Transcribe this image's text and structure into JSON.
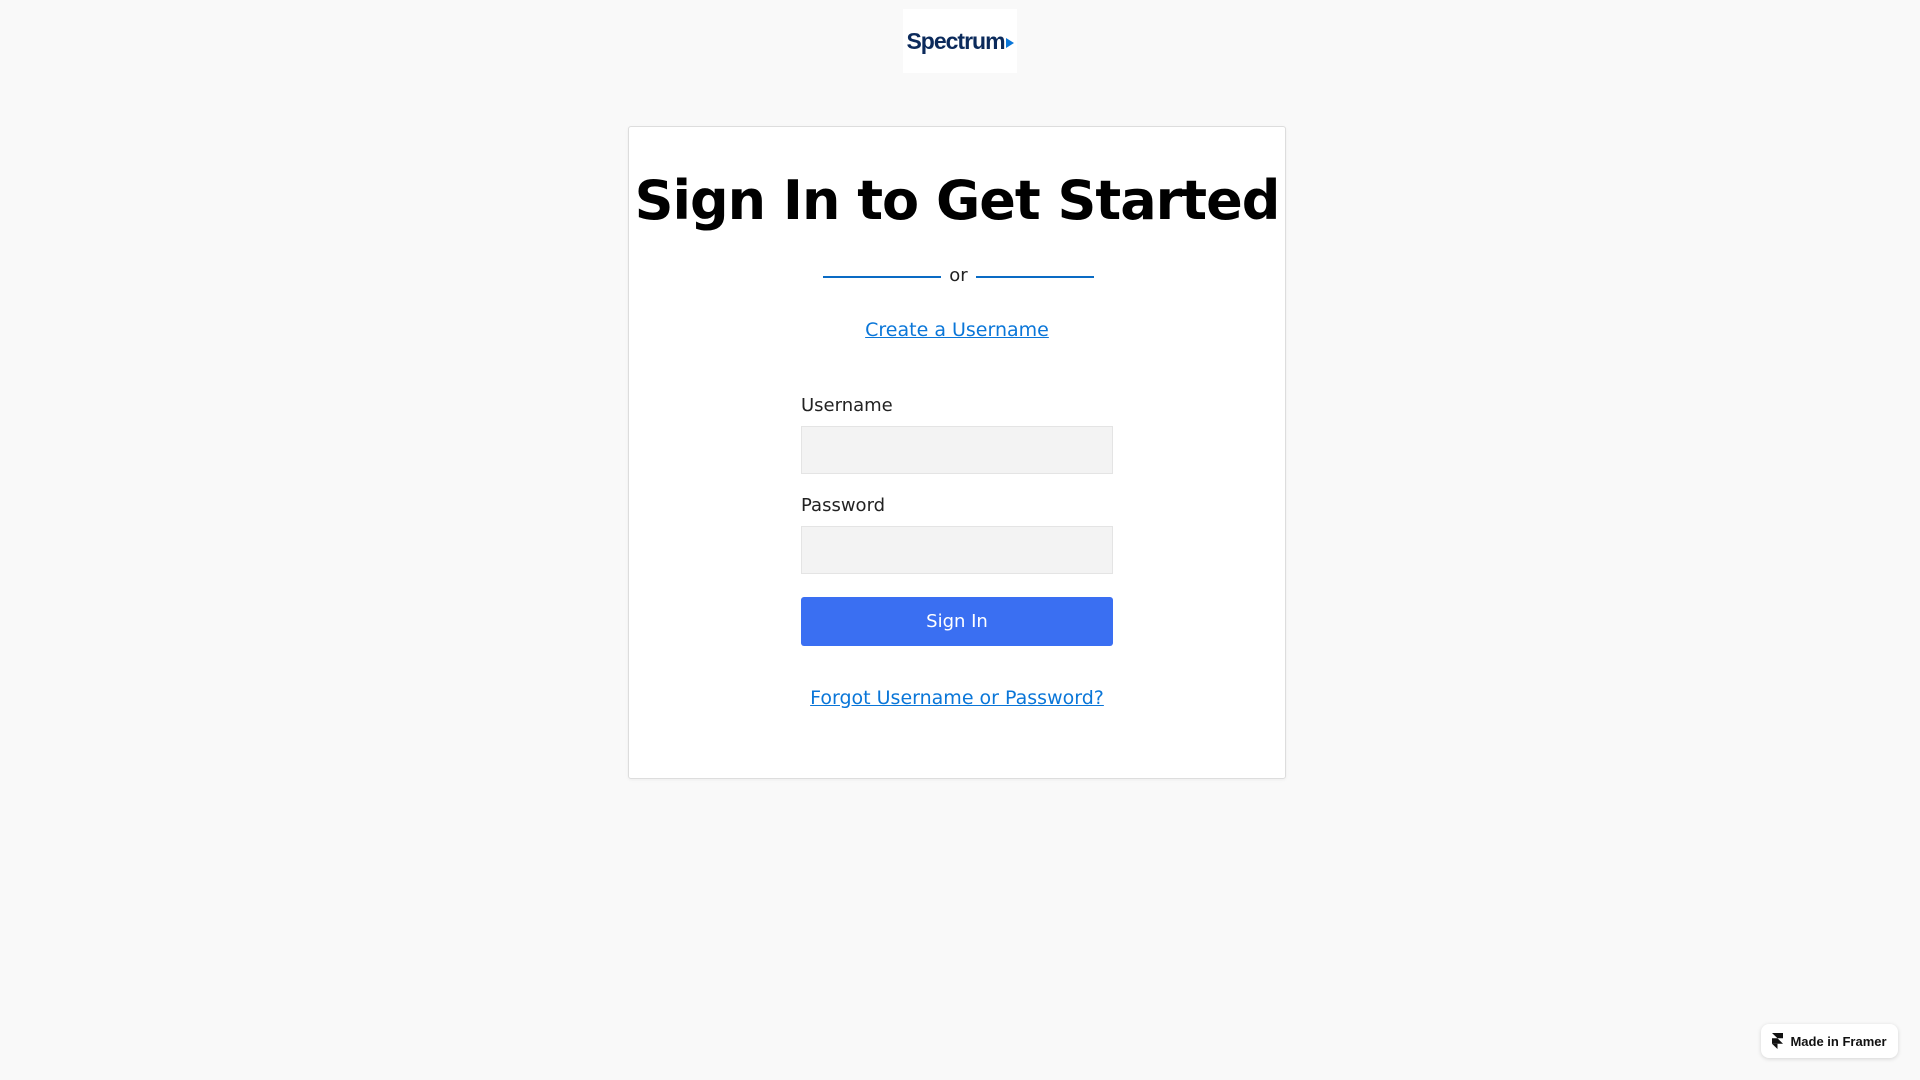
{
  "logo": {
    "text": "Spectrum"
  },
  "login": {
    "title": "Sign In to Get Started",
    "divider_text": "or",
    "create_username": "Create a Username",
    "username_label": "Username",
    "username_value": "",
    "password_label": "Password",
    "password_value": "",
    "sign_in_label": "Sign In",
    "forgot_link": "Forgot Username or Password?"
  },
  "badge": {
    "label": "Made in Framer",
    "icon": "framer-logo-icon"
  },
  "colors": {
    "background": "#f9f9f9",
    "button": "#3a6ff2",
    "link": "#0a76d8",
    "logo_text": "#0b2a5b",
    "divider": "#0a6bc4"
  }
}
